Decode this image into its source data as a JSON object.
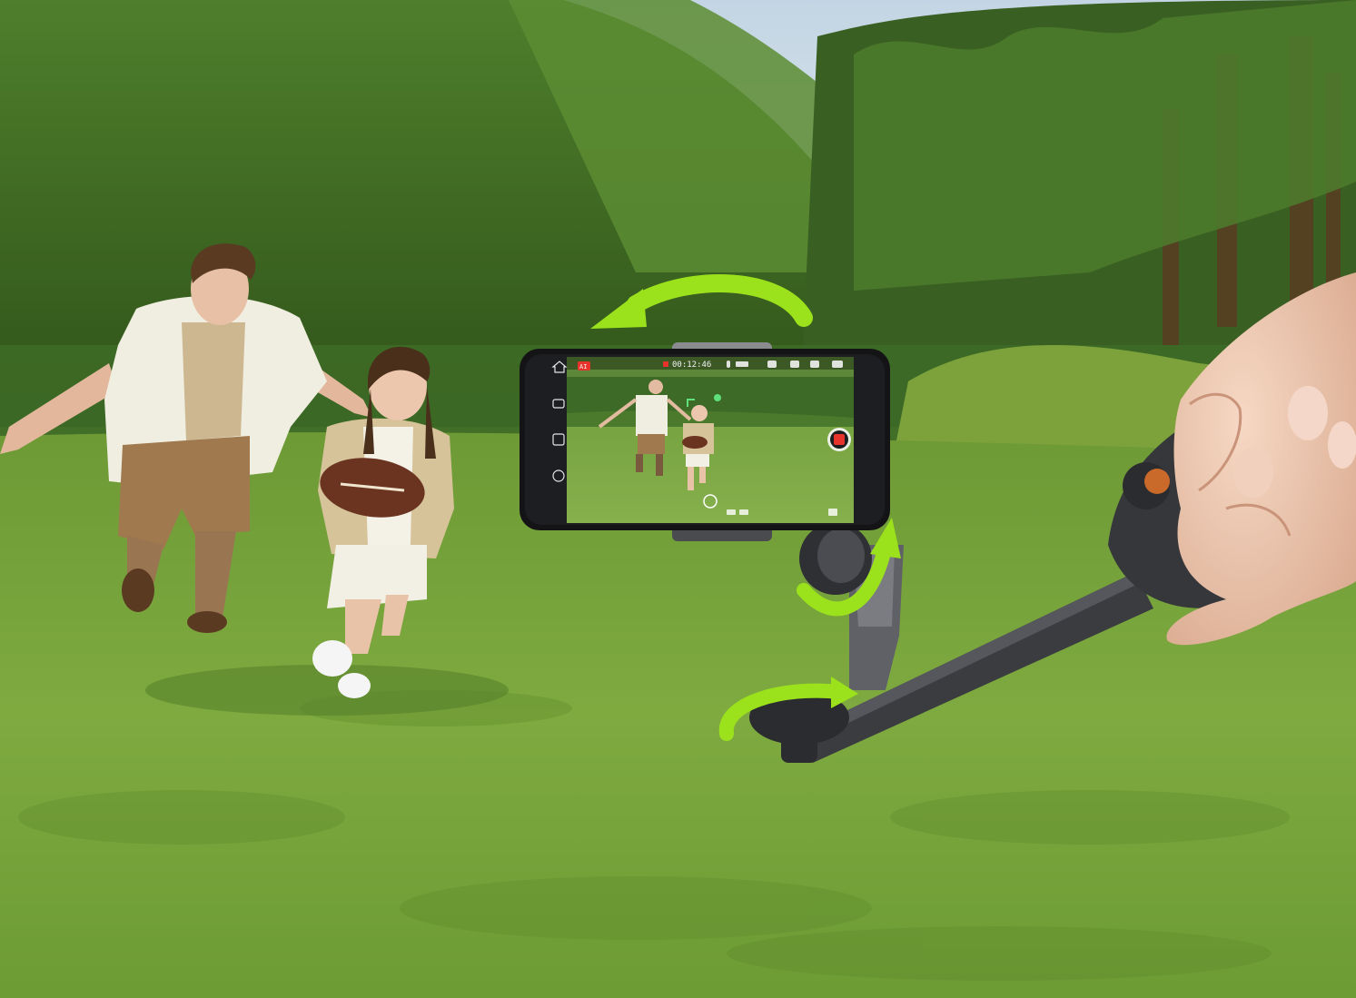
{
  "phone_screen": {
    "record_timer": "00:12:46",
    "top_left_label": "AI"
  },
  "colors": {
    "sky": "#c9d9e6",
    "hills": "#3f6a24",
    "forest": "#2e4d1c",
    "grass": "#7faa3f",
    "accent_arrows": "#9be21c",
    "gimbal": "#3a3b3e",
    "record_button": "#e8332c"
  },
  "icons": {
    "rotation_arrows": "curved-arrow-icon",
    "record": "record-button-icon"
  }
}
